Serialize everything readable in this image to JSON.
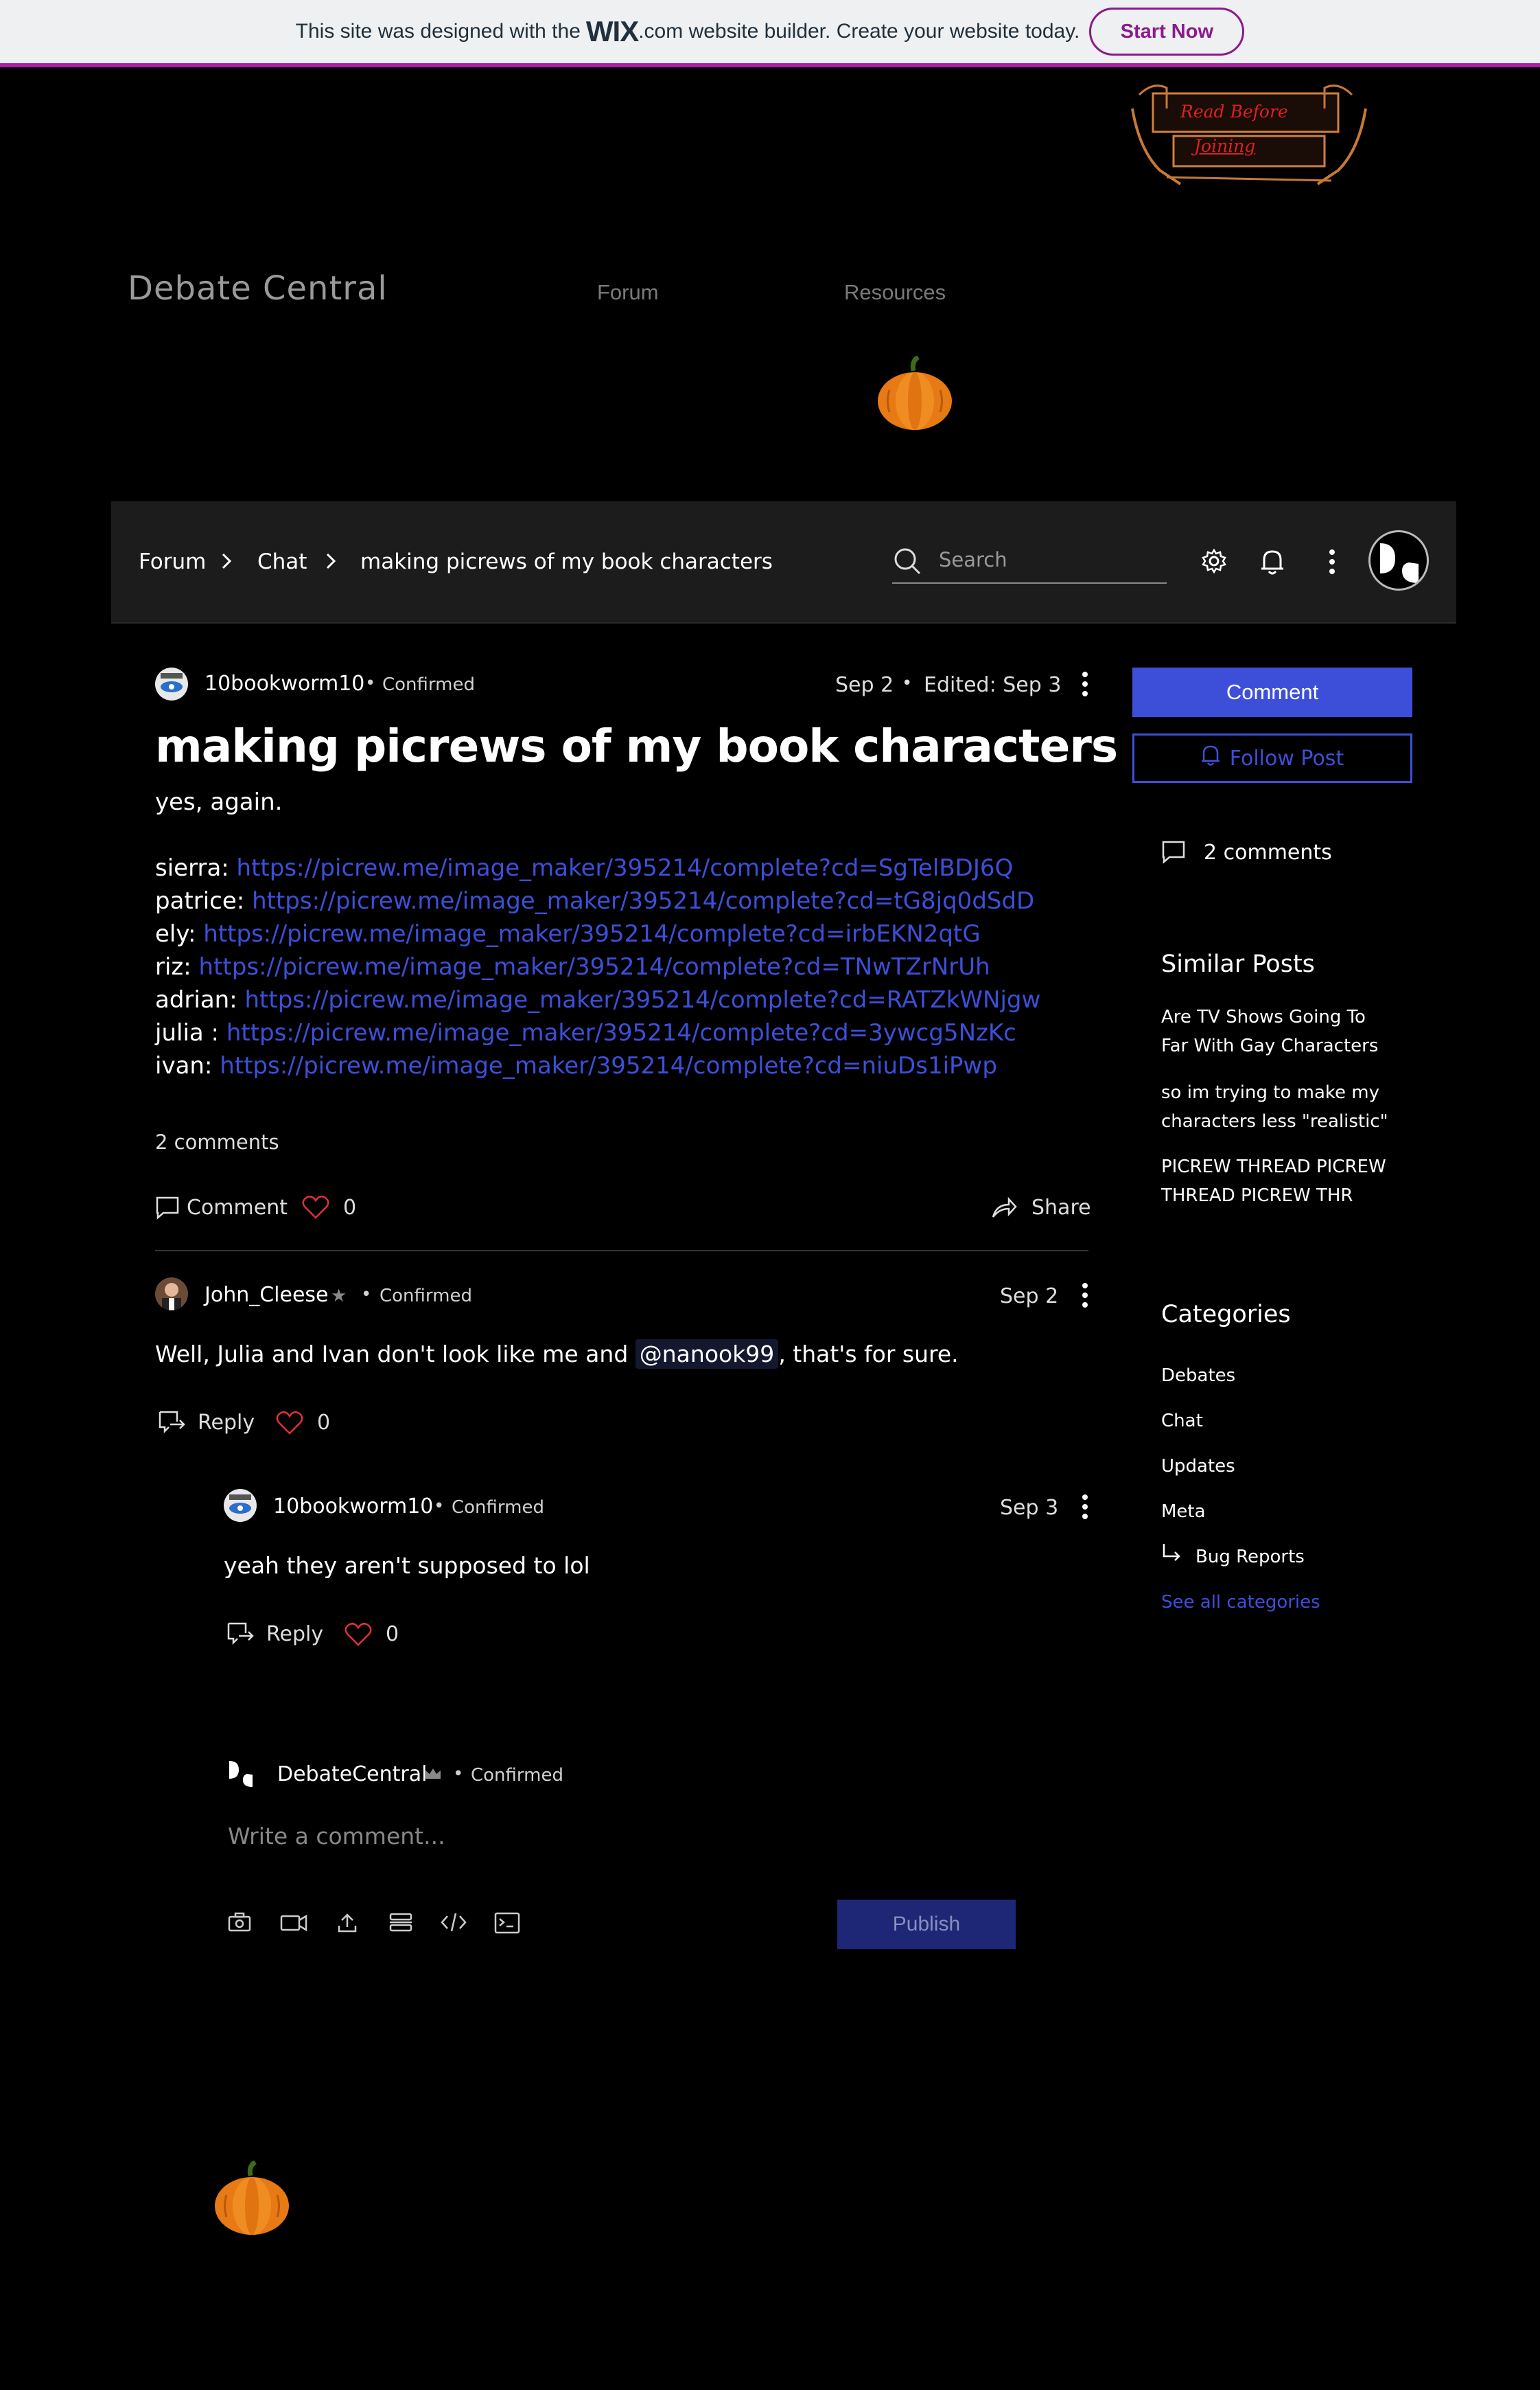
{
  "banner": {
    "text_before": "This site was designed with the",
    "logo": "WIX",
    "text_after": ".com website builder. Create your website today.",
    "cta": "Start Now"
  },
  "header": {
    "sign_text_1": "Read Before",
    "sign_text_2": "Joining",
    "site_title": "Debate Central",
    "nav": [
      "Forum",
      "Resources"
    ]
  },
  "toolbar": {
    "breadcrumb": [
      "Forum",
      "Chat",
      "making picrews of my book characters"
    ],
    "search_placeholder": "Search"
  },
  "post": {
    "author": "10bookworm10",
    "badge": "Confirmed",
    "date": "Sep 2",
    "edited": "Edited: Sep 3",
    "title": "making picrews of my book characters",
    "intro": "yes, again.",
    "links": [
      {
        "name": "sierra:",
        "url": "https://picrew.me/image_maker/395214/complete?cd=SgTelBDJ6Q"
      },
      {
        "name": "patrice:",
        "url": "https://picrew.me/image_maker/395214/complete?cd=tG8jq0dSdD"
      },
      {
        "name": "ely:",
        "url": "https://picrew.me/image_maker/395214/complete?cd=irbEKN2qtG"
      },
      {
        "name": "riz:",
        "url": "https://picrew.me/image_maker/395214/complete?cd=TNwTZrNrUh"
      },
      {
        "name": "adrian:",
        "url": "https://picrew.me/image_maker/395214/complete?cd=RATZkWNjgw"
      },
      {
        "name": "julia :",
        "url": "https://picrew.me/image_maker/395214/complete?cd=3ywcg5NzKc"
      },
      {
        "name": "ivan:",
        "url": "https://picrew.me/image_maker/395214/complete?cd=niuDs1iPwp"
      }
    ],
    "comment_count": "2 comments",
    "comment_label": "Comment",
    "likes": "0",
    "share_label": "Share"
  },
  "comments": [
    {
      "author": "John_Cleese",
      "badge": "Confirmed",
      "date": "Sep 2",
      "text_before": "Well, Julia and Ivan don't look like me and",
      "mention": "@nanook99",
      "text_after": ", that's for sure.",
      "reply_label": "Reply",
      "likes": "0"
    },
    {
      "author": "10bookworm10",
      "badge": "Confirmed",
      "date": "Sep 3",
      "text": "yeah they aren't supposed to lol",
      "reply_label": "Reply",
      "likes": "0"
    }
  ],
  "composer": {
    "author": "DebateCentral",
    "badge": "Confirmed",
    "placeholder": "Write a comment...",
    "publish_label": "Publish"
  },
  "sidebar": {
    "comment_button": "Comment",
    "follow_button": "Follow Post",
    "comments_count": "2 comments",
    "similar_heading": "Similar Posts",
    "similar_posts": [
      [
        "Are TV Shows Going To",
        "Far With Gay Characters"
      ],
      [
        "so im trying to make my",
        "characters less \"realistic\""
      ],
      [
        "PICREW THREAD PICREW",
        "THREAD PICREW THR"
      ]
    ],
    "categories_heading": "Categories",
    "categories": [
      "Debates",
      "Chat",
      "Updates",
      "Meta"
    ],
    "subcategory": "Bug Reports",
    "see_all": "See all categories"
  },
  "colors": {
    "accent": "#3d4fd9",
    "banner_bg": "#eef0f2",
    "banner_border": "#b01ea8",
    "like_red": "#e0303c"
  },
  "icons": [
    "pumpkin-icon",
    "search-icon",
    "gear-icon",
    "bell-icon",
    "more-icon",
    "chevron-right-icon",
    "comment-icon",
    "heart-icon",
    "share-icon",
    "reply-icon",
    "camera-icon",
    "video-icon",
    "upload-icon",
    "divider-icon",
    "code-icon",
    "embed-icon",
    "crown-icon",
    "star-icon",
    "subcategory-arrow-icon"
  ]
}
